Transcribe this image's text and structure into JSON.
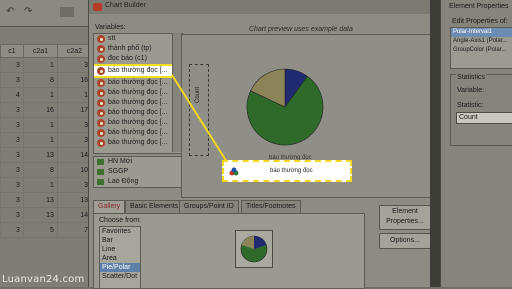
{
  "sheet": {
    "columns": [
      "c1",
      "c2a1",
      "c2a2"
    ],
    "rows": [
      [
        "3",
        "1",
        "3"
      ],
      [
        "3",
        "8",
        "16"
      ],
      [
        "4",
        "1",
        "1"
      ],
      [
        "3",
        "16",
        "17"
      ],
      [
        "3",
        "1",
        "3"
      ],
      [
        "3",
        "1",
        "3"
      ],
      [
        "3",
        "13",
        "14"
      ],
      [
        "3",
        "8",
        "10"
      ],
      [
        "3",
        "1",
        "3"
      ],
      [
        "3",
        "13",
        "13"
      ],
      [
        "3",
        "13",
        "14"
      ],
      [
        "3",
        "5",
        "7"
      ]
    ]
  },
  "dialog": {
    "title": "Chart Builder",
    "variables_label": "Variables:",
    "variables": [
      "stt",
      "thành phố (tp)",
      "đọc báo (c1)",
      "báo thường đọc [...",
      "báo thường đọc [...",
      "báo thường đọc [...",
      "báo thường đọc [...",
      "báo thường đọc [...",
      "báo thường đọc [...",
      "báo thường đọc [...",
      "báo thường đọc [..."
    ],
    "selected_variable_index": 3,
    "variables2": [
      "HN Mới",
      "SGGP",
      "Lao Động"
    ],
    "preview_label": "Chart preview uses example data",
    "y_drop_label": "Count",
    "x_drop_label": "báo thường đọc",
    "drag_label": "báo thường đọc",
    "tabs": [
      "Gallery",
      "Basic Elements",
      "Groups/Point ID",
      "Titles/Footnotes"
    ],
    "choose_from_label": "Choose from:",
    "choose_from": [
      "Favorites",
      "Bar",
      "Line",
      "Area",
      "Pie/Polar",
      "Scatter/Dot"
    ],
    "choose_selected_index": 4,
    "element_properties_button": "Element Properties...",
    "options_button": "Options..."
  },
  "pie_preview": {
    "slices": [
      {
        "label": "slice-blue",
        "fraction": 0.1,
        "color": "#1f2a70"
      },
      {
        "label": "slice-green",
        "fraction": 0.72,
        "color": "#2f6a2a"
      },
      {
        "label": "slice-tan",
        "fraction": 0.18,
        "color": "#8a8458"
      }
    ]
  },
  "props": {
    "title": "Element Properties",
    "edit_label": "Edit Properties of:",
    "items": [
      "Polar-Interval1",
      "Angle-Axis1 (Polar...",
      "GroupColor (Polar..."
    ],
    "selected_index": 0,
    "stats_header": "Statistics",
    "variable_label": "Variable:",
    "statistic_label": "Statistic:",
    "statistic_value": "Count"
  },
  "watermark": "Luanvan24.com",
  "colors": {
    "highlight": "#f3d81f",
    "pie_blue": "#1f2a70",
    "pie_green": "#2f6a2a",
    "pie_tan": "#8a8458"
  }
}
